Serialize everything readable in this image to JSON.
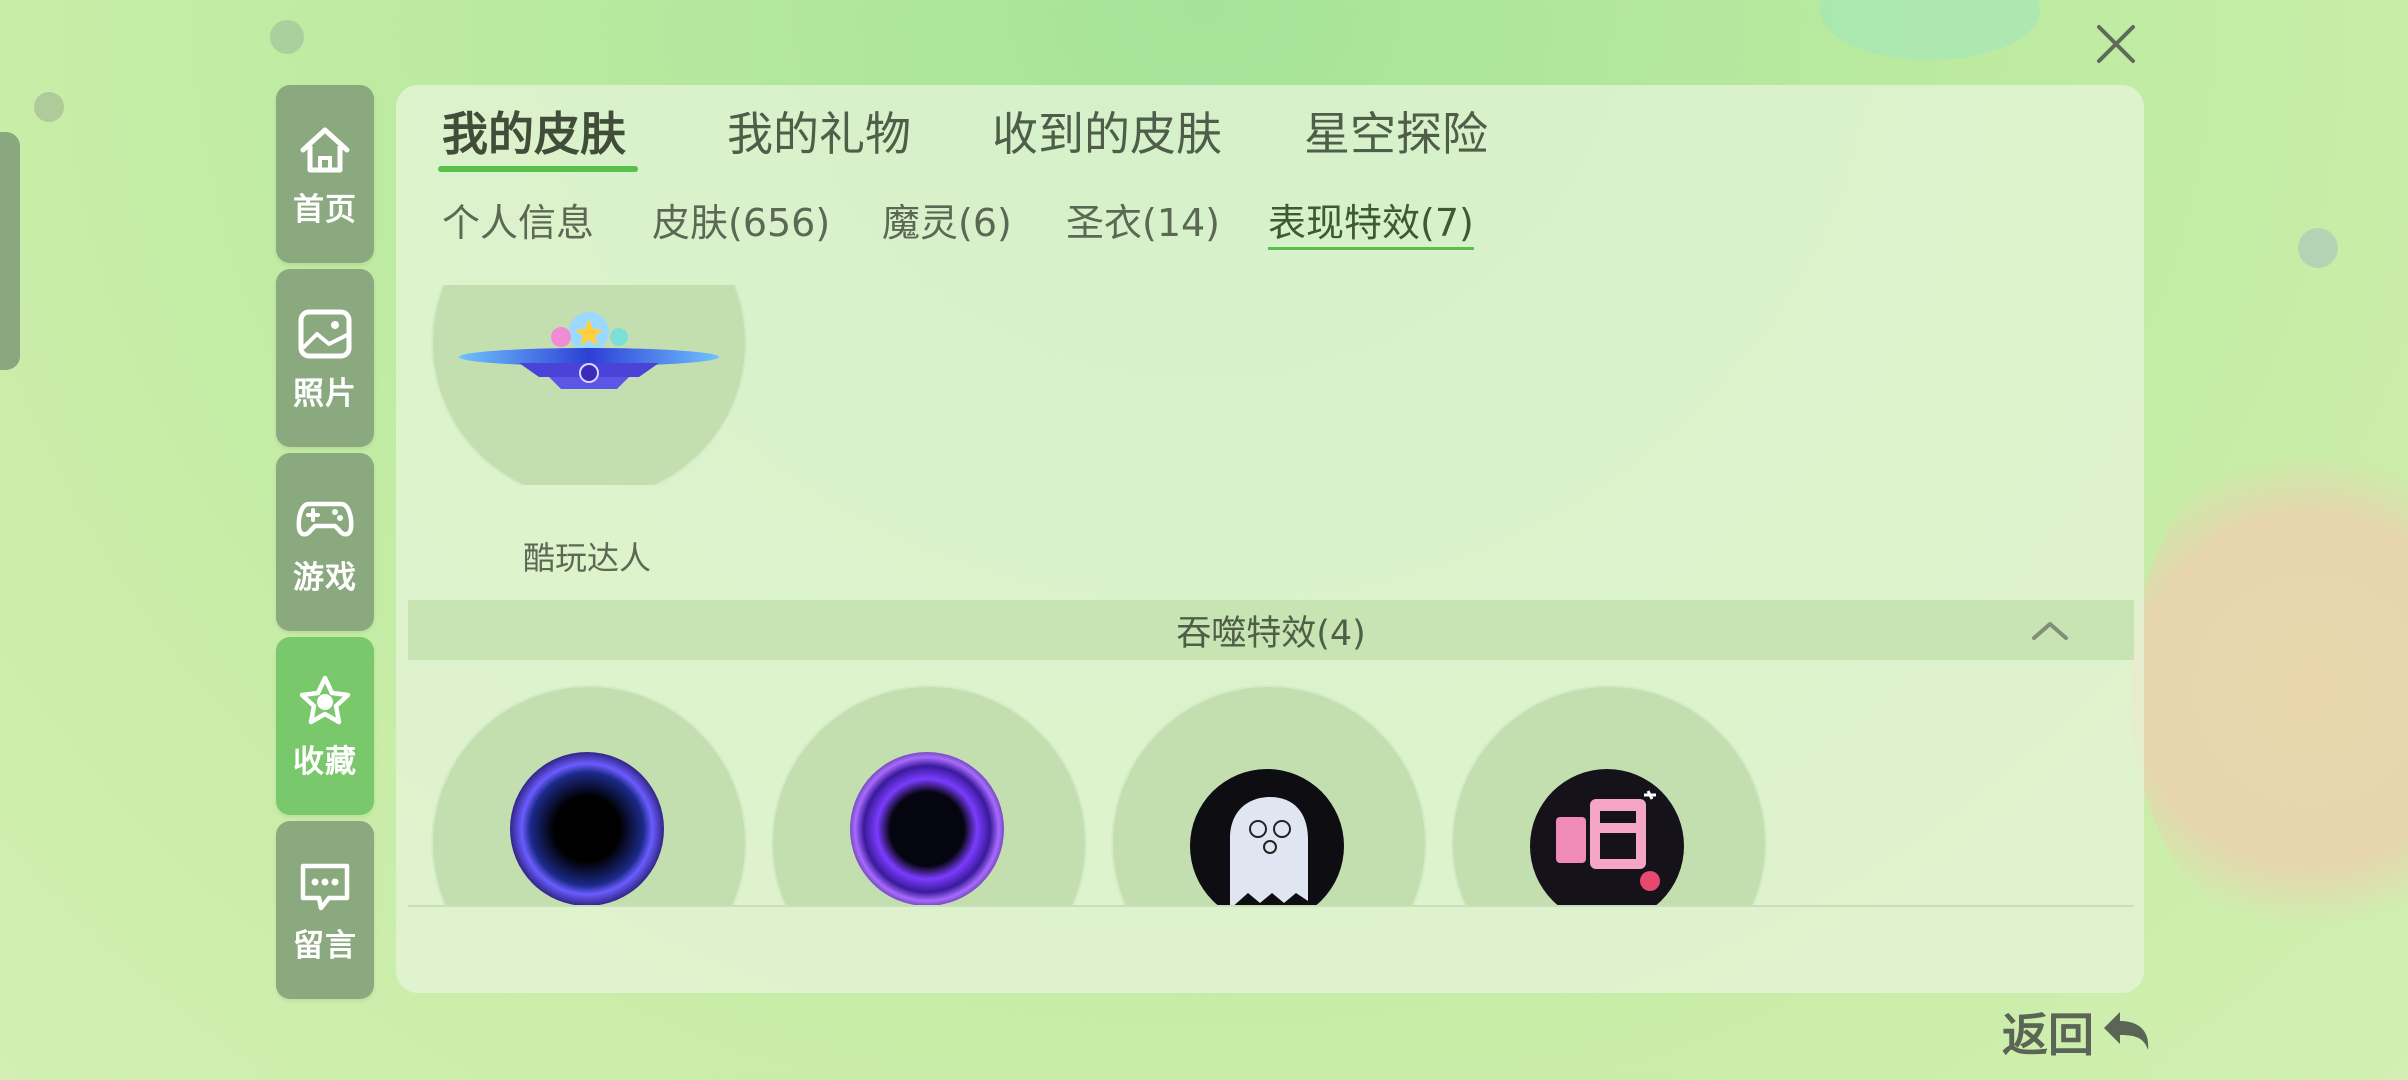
{
  "sidebar": {
    "items": [
      {
        "label": "首页",
        "icon": "home-icon",
        "active": false
      },
      {
        "label": "照片",
        "icon": "photo-icon",
        "active": false
      },
      {
        "label": "游戏",
        "icon": "gamepad-icon",
        "active": false
      },
      {
        "label": "收藏",
        "icon": "star-icon",
        "active": true
      },
      {
        "label": "留言",
        "icon": "message-icon",
        "active": false
      }
    ]
  },
  "tabs": [
    {
      "label": "我的皮肤",
      "active": true
    },
    {
      "label": "我的礼物",
      "active": false
    },
    {
      "label": "收到的皮肤",
      "active": false
    },
    {
      "label": "星空探险",
      "active": false
    }
  ],
  "subtabs": [
    {
      "label": "个人信息",
      "active": false
    },
    {
      "label": "皮肤(656)",
      "active": false
    },
    {
      "label": "魔灵(6)",
      "active": false
    },
    {
      "label": "圣衣(14)",
      "active": false
    },
    {
      "label": "表现特效(7)",
      "active": true
    }
  ],
  "first_item": {
    "label": "酷玩达人"
  },
  "section": {
    "title": "吞噬特效(4)",
    "expanded": true
  },
  "section_items": [
    {
      "icon": "purple-vortex"
    },
    {
      "icon": "violet-ring"
    },
    {
      "icon": "ghost"
    },
    {
      "icon": "pink-text-sticker"
    }
  ],
  "back": {
    "label": "返回"
  },
  "colors": {
    "accent": "#5bbf4b",
    "sidebar": "#8aa97f",
    "sidebar_active": "#79c86b"
  }
}
